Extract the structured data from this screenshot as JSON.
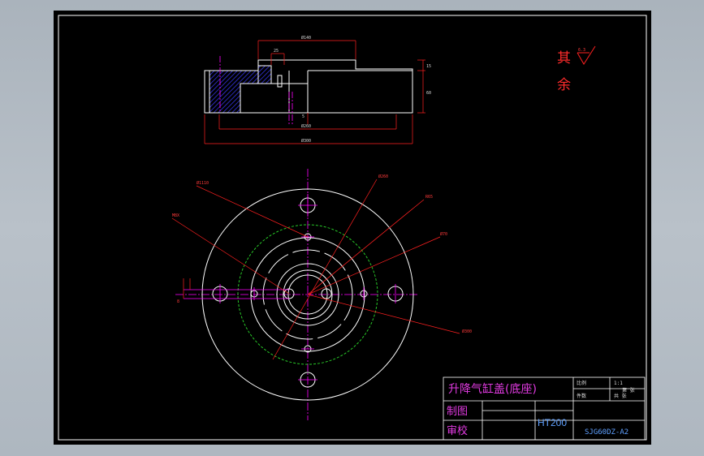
{
  "plan_view": {
    "dimensions": {
      "top_diameter": "Ø140",
      "small_width": "25",
      "height_top": "15",
      "height_right": "60",
      "chamfer_small": "5",
      "inner_diameter": "Ø260",
      "outer_diameter": "Ø300"
    }
  },
  "front_view": {
    "callouts": {
      "hole_small": "Ø1110",
      "hole_left": "M8X",
      "circle_large": "Ø260",
      "circle_mid": "R65",
      "circle_r": "Ø70",
      "circle_outer": "Ø300",
      "depth": "8"
    }
  },
  "rest_note": {
    "text": "其余",
    "roughness": "6.3"
  },
  "title_block": {
    "part_name": "升降气缸盖(底座)",
    "drawn_label": "制图",
    "checked_label": "审校",
    "material": "HT200",
    "drawing_number": "SJG60DZ-A2",
    "scale_label": "比例",
    "scale_value": "1:1",
    "qty_label": "件数",
    "sheet_label": "共 张",
    "sheet_value": "第 张"
  },
  "colors": {
    "background": "#000000",
    "outline": "#ffffff",
    "center_line": "#ff00ff",
    "dimension": "#ff2020",
    "hatch": "#3a3aff",
    "pitch_circle": "#28c828",
    "title": "#e03ae0",
    "material": "#5fa0ff"
  }
}
